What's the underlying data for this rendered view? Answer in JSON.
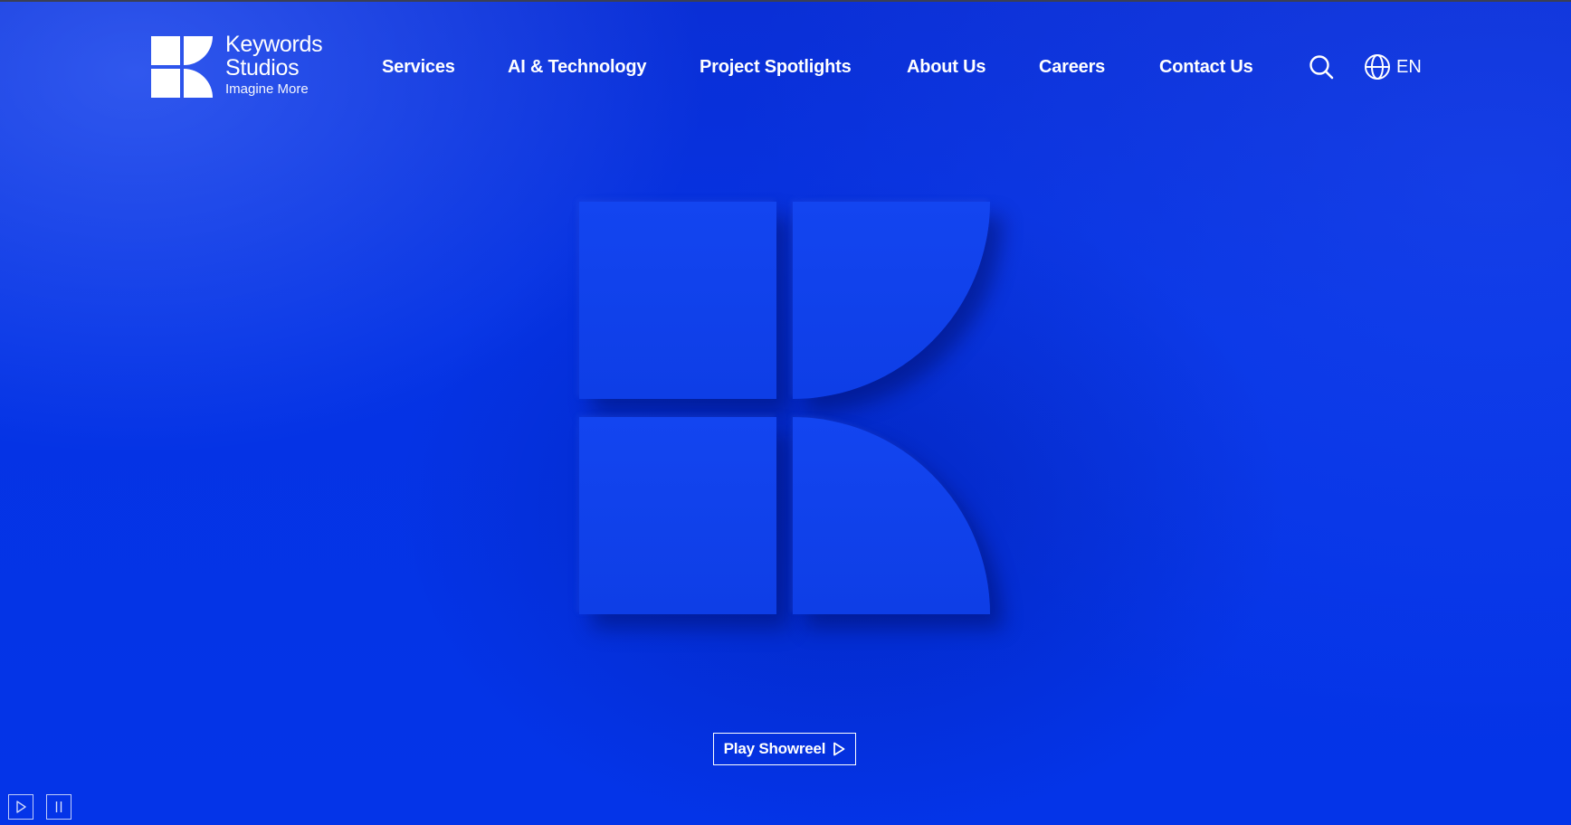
{
  "brand": {
    "name": "Keywords Studios",
    "tagline": "Imagine More",
    "logo_icon": "keywords-k-logo-icon",
    "color_background": "#0434e8",
    "color_text": "#ffffff"
  },
  "nav": {
    "items": [
      {
        "label": "Services"
      },
      {
        "label": "AI & Technology"
      },
      {
        "label": "Project Spotlights"
      },
      {
        "label": "About Us"
      },
      {
        "label": "Careers"
      },
      {
        "label": "Contact Us"
      }
    ],
    "search_icon": "search-icon",
    "language": {
      "icon": "globe-icon",
      "code": "EN"
    }
  },
  "hero": {
    "graphic": "large-k-logo-mark",
    "showreel_label": "Play Showreel",
    "showreel_icon": "play-triangle-icon"
  },
  "video_controls": {
    "play_icon": "play-icon",
    "pause_icon": "pause-icon"
  }
}
